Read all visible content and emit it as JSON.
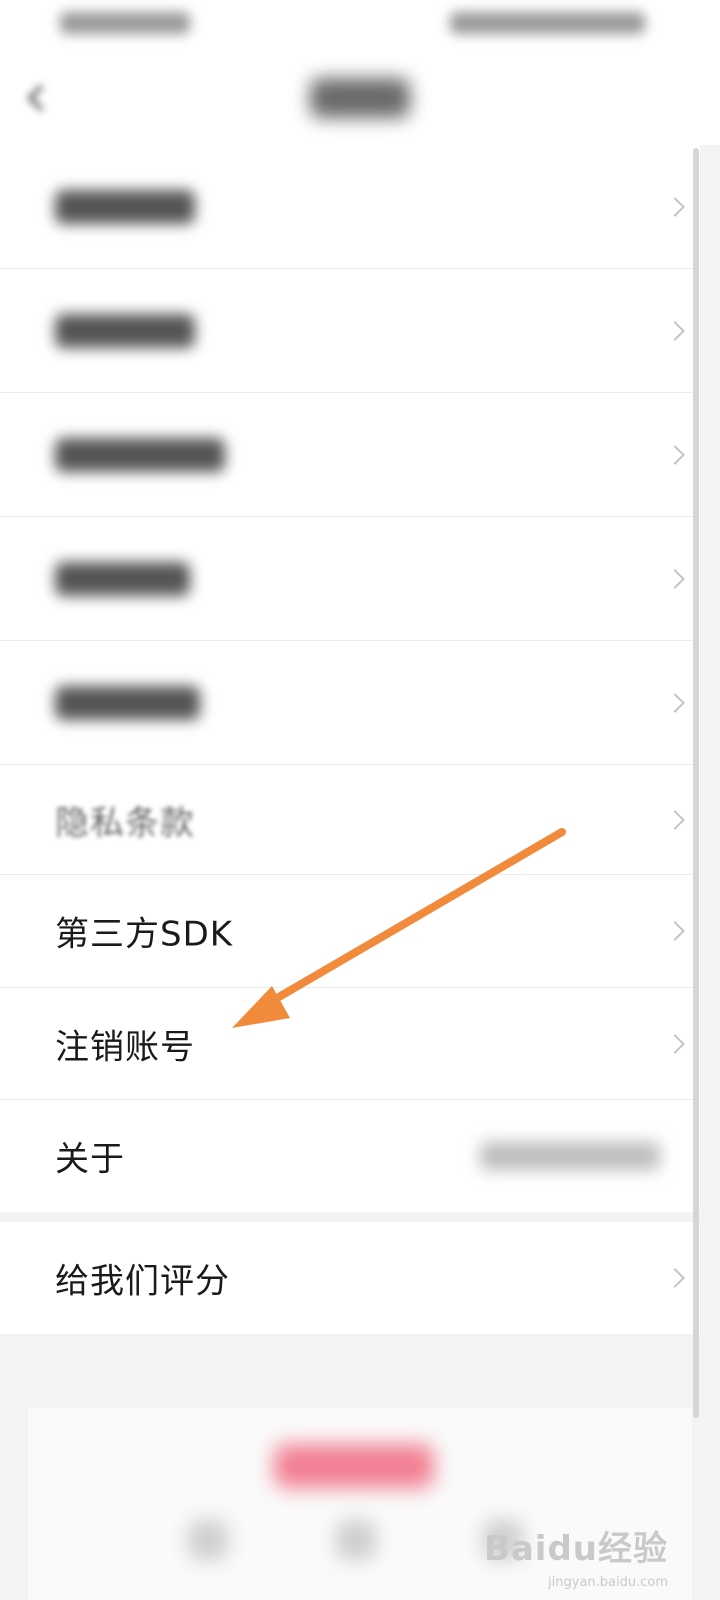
{
  "settings_menu": {
    "groups": [
      {
        "items": [
          {
            "label": ""
          },
          {
            "label": ""
          },
          {
            "label": ""
          },
          {
            "label": ""
          },
          {
            "label": ""
          },
          {
            "label": "隐私条款"
          },
          {
            "label": "第三方SDK"
          },
          {
            "label": "注销账号"
          },
          {
            "label": "关于"
          }
        ]
      },
      {
        "items": [
          {
            "label": "给我们评分"
          }
        ]
      }
    ]
  },
  "watermark": {
    "text": "Baidu经验",
    "sub": "jingyan.baidu.com"
  },
  "annotation": {
    "arrow_color": "#f28a3b"
  }
}
